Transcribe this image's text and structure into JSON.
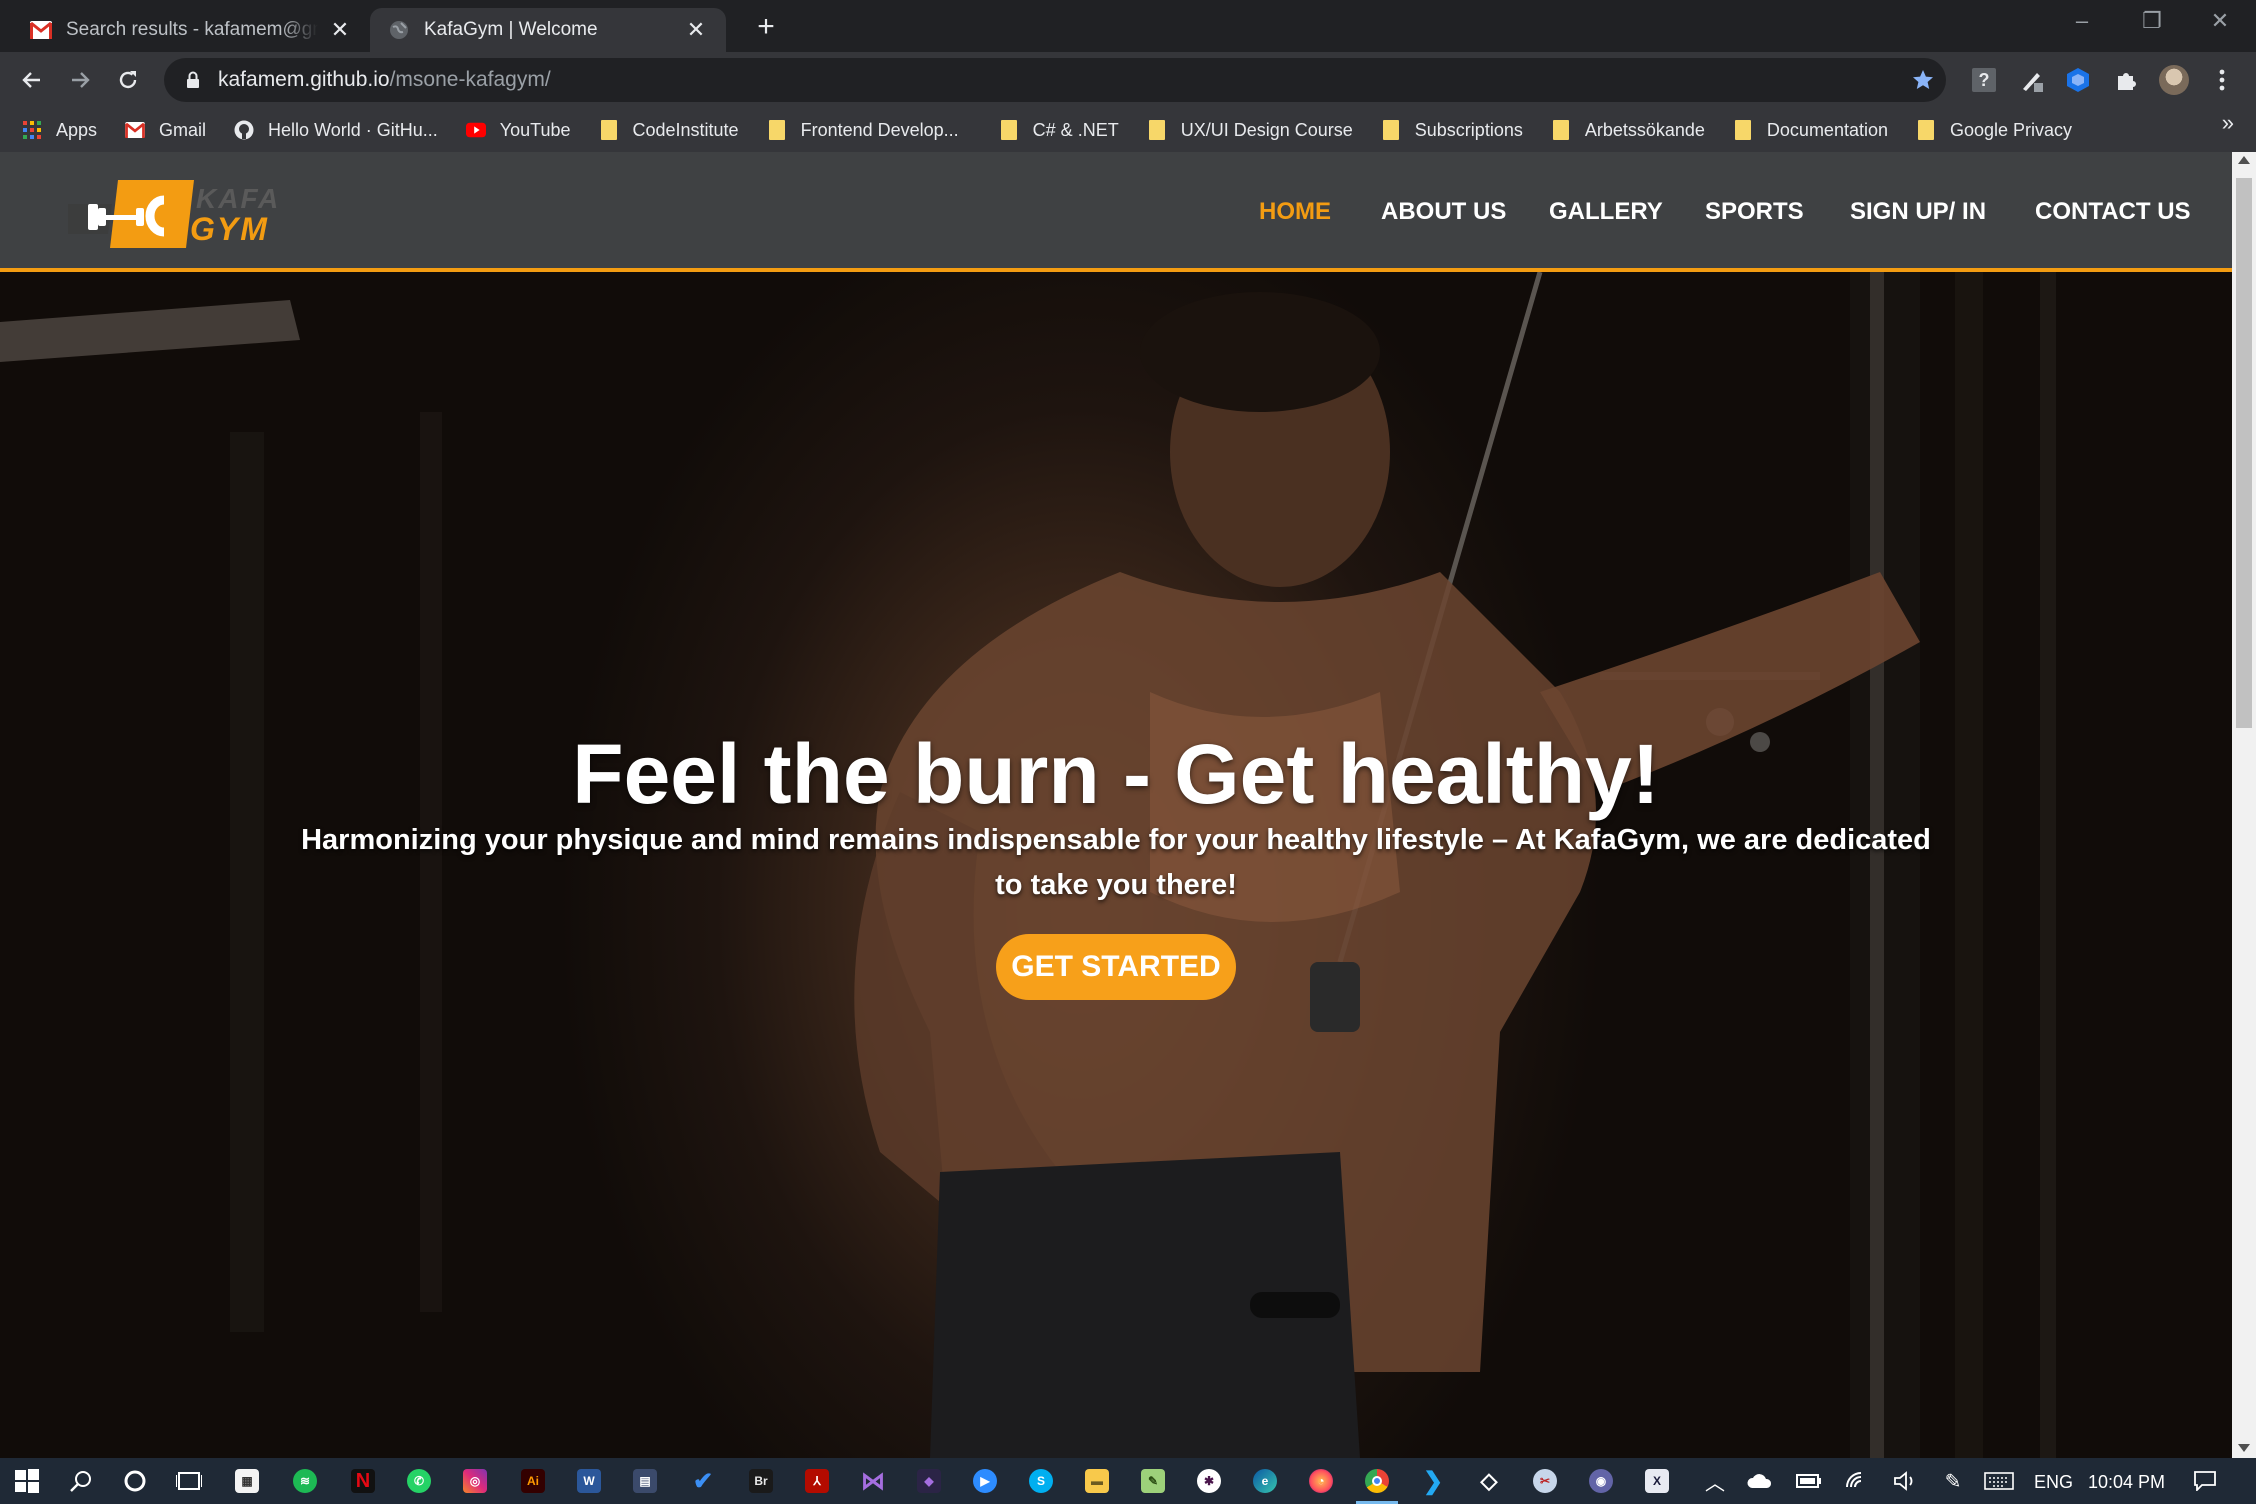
{
  "browser": {
    "tabs": [
      {
        "title": "Search results - kafamem@gmail.com",
        "favicon": "gmail-icon",
        "active": false
      },
      {
        "title": "KafaGym | Welcome",
        "favicon": "globe-icon",
        "active": true
      }
    ],
    "url_host": "kafamem.github.io",
    "url_path": "/msone-kafagym/",
    "bookmarks": [
      {
        "label": "Apps",
        "icon": "apps-grid-icon"
      },
      {
        "label": "Gmail",
        "icon": "gmail-icon"
      },
      {
        "label": "Hello World · GitHu...",
        "icon": "github-icon"
      },
      {
        "label": "YouTube",
        "icon": "youtube-icon"
      },
      {
        "label": "CodeInstitute",
        "icon": "folder-icon"
      },
      {
        "label": "Frontend Develop...",
        "icon": "folder-icon"
      },
      {
        "label": "C# & .NET",
        "icon": "folder-icon"
      },
      {
        "label": "UX/UI Design Course",
        "icon": "folder-icon"
      },
      {
        "label": "Subscriptions",
        "icon": "folder-icon"
      },
      {
        "label": "Arbetssökande",
        "icon": "folder-icon"
      },
      {
        "label": "Documentation",
        "icon": "folder-icon"
      },
      {
        "label": "Google Privacy",
        "icon": "folder-icon"
      }
    ],
    "more_bookmarks": "»"
  },
  "site": {
    "logo": {
      "line1": "KAFA",
      "line2": "GYM"
    },
    "nav": [
      {
        "label": "HOME",
        "active": true
      },
      {
        "label": "ABOUT US",
        "active": false
      },
      {
        "label": "GALLERY",
        "active": false
      },
      {
        "label": "SPORTS",
        "active": false
      },
      {
        "label": "SIGN UP/ IN",
        "active": false
      },
      {
        "label": "CONTACT US",
        "active": false
      }
    ],
    "hero": {
      "title": "Feel the burn - Get healthy!",
      "subtitle": "Harmonizing your physique and mind remains indispensable for your healthy lifestyle – At KafaGym, we are dedicated to take you there!",
      "cta": "GET STARTED"
    },
    "colors": {
      "accent": "#f39c12",
      "navbar": "#3f4143",
      "button": "#f7a01a"
    }
  },
  "taskbar": {
    "apps": [
      "windows-start-icon",
      "search-icon",
      "cortana-icon",
      "task-view-icon",
      "store-icon",
      "spotify-icon",
      "netflix-icon",
      "whatsapp-icon",
      "instagram-icon",
      "illustrator-icon",
      "word-icon",
      "calculator-icon",
      "todo-icon",
      "bridge-icon",
      "acrobat-icon",
      "visual-studio-icon",
      "vs-preview-icon",
      "zoom-icon",
      "skype-icon",
      "file-explorer-icon",
      "notepad-icon",
      "slack-icon",
      "edge-icon",
      "firefox-icon",
      "chrome-icon",
      "vscode-icon",
      "dropbox-icon",
      "snip-icon",
      "teams-icon",
      "xd-icon"
    ],
    "lang": "ENG",
    "time": "10:04 PM"
  }
}
